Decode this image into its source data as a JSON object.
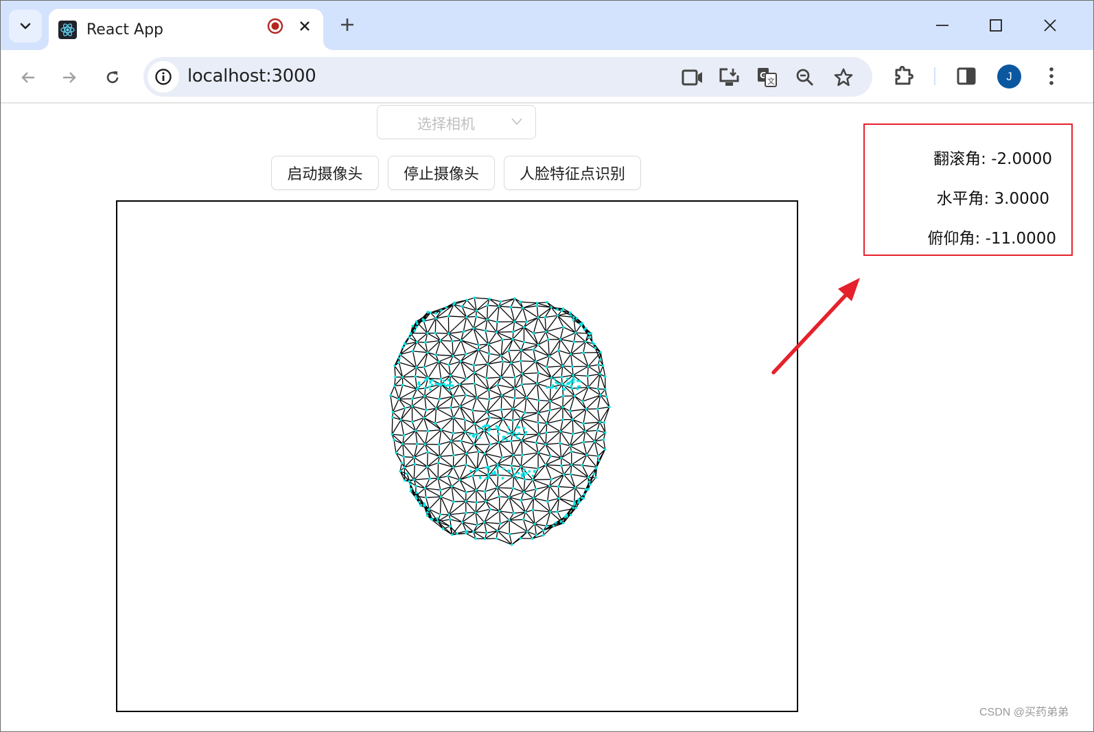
{
  "browser": {
    "tab": {
      "title": "React App",
      "favicon": "react-logo-icon",
      "recording_indicator": "record-icon",
      "close_icon": "close-icon"
    },
    "new_tab_icon": "plus-icon",
    "tab_search_icon": "chevron-down-icon",
    "window_controls": [
      "minimize-icon",
      "maximize-icon",
      "close-icon"
    ],
    "nav": {
      "back_icon": "arrow-left-icon",
      "forward_icon": "arrow-right-icon",
      "reload_icon": "reload-icon"
    },
    "omnibox": {
      "site_info_icon": "info-icon",
      "url": "localhost:3000",
      "actions": [
        "camera-in-use-icon",
        "install-app-icon",
        "translate-icon",
        "zoom-out-icon",
        "bookmark-star-icon"
      ]
    },
    "toolbar_actions": [
      "extensions-puzzle-icon",
      "side-panel-icon",
      "profile-avatar",
      "more-menu-icon"
    ],
    "profile_initial": "J",
    "accent_color": "#0b57a0"
  },
  "page": {
    "camera_select": {
      "placeholder": "选择相机",
      "selected": null
    },
    "buttons": {
      "start_camera": "启动摄像头",
      "stop_camera": "停止摄像头",
      "face_landmarks": "人脸特征点识别"
    },
    "canvas": {
      "content": "face-mesh-wireframe",
      "mesh_color": "#000000",
      "landmark_color": "#00e5e5"
    },
    "pose": {
      "roll_label": "翻滚角",
      "roll_value": "-2.0000",
      "yaw_label": "水平角",
      "yaw_value": "3.0000",
      "pitch_label": "俯仰角",
      "pitch_value": "-11.0000",
      "highlight_color": "#e5212b"
    },
    "annotation_arrow_color": "#e5212b",
    "watermark": "CSDN @买药弟弟"
  }
}
